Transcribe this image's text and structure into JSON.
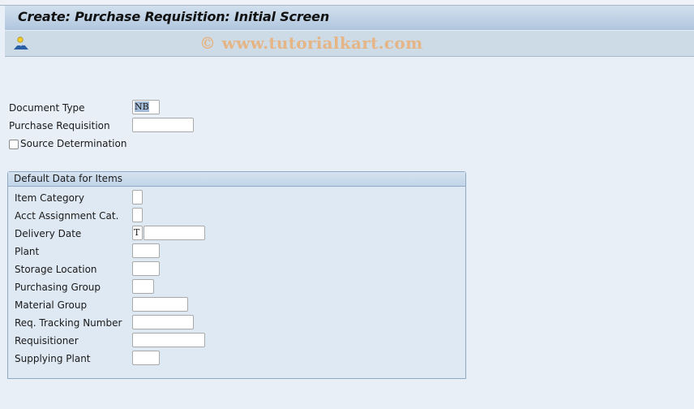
{
  "window": {
    "title": "Create: Purchase Requisition: Initial Screen",
    "watermark": "© www.tutorialkart.com"
  },
  "toolbar": {
    "icons": [
      {
        "name": "personal-settings-icon",
        "tooltip": ""
      }
    ]
  },
  "header_fields": {
    "document_type": {
      "label": "Document Type",
      "value": "NB"
    },
    "purchase_requisition": {
      "label": "Purchase Requisition",
      "value": ""
    },
    "source_determination": {
      "label": "Source Determination",
      "checked": false
    }
  },
  "default_data": {
    "title": "Default Data for Items",
    "item_category": {
      "label": "Item Category",
      "value": ""
    },
    "acct_assignment_cat": {
      "label": "Acct Assignment Cat.",
      "value": ""
    },
    "delivery_date": {
      "label": "Delivery Date",
      "format_value": "T",
      "value": ""
    },
    "plant": {
      "label": "Plant",
      "value": ""
    },
    "storage_location": {
      "label": "Storage Location",
      "value": ""
    },
    "purchasing_group": {
      "label": "Purchasing Group",
      "value": ""
    },
    "material_group": {
      "label": "Material Group",
      "value": ""
    },
    "req_tracking_number": {
      "label": "Req. Tracking Number",
      "value": ""
    },
    "requisitioner": {
      "label": "Requisitioner",
      "value": ""
    },
    "supplying_plant": {
      "label": "Supplying Plant",
      "value": ""
    }
  }
}
